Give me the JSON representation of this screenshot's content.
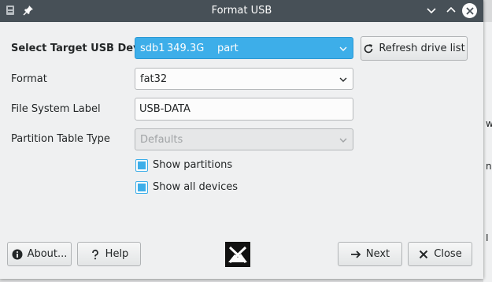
{
  "background": {
    "fragments": [
      "w",
      "nd",
      "I"
    ]
  },
  "window": {
    "title": "Format USB"
  },
  "form": {
    "device": {
      "label": "Select Target USB Device",
      "name": "sdb1",
      "size": "349.3G",
      "type": "part"
    },
    "refresh_label": "Refresh drive list",
    "format": {
      "label": "Format",
      "value": "fat32"
    },
    "fs_label": {
      "label": "File System Label",
      "value": "USB-DATA"
    },
    "partition_table": {
      "label": "Partition Table Type",
      "value": "Defaults"
    },
    "show_partitions": {
      "label": "Show partitions",
      "checked": true
    },
    "show_all_devices": {
      "label": "Show all devices",
      "checked": true
    }
  },
  "buttons": {
    "about": "About...",
    "help": "Help",
    "next": "Next",
    "close": "Close"
  },
  "colors": {
    "accent": "#3daee9",
    "titlebar": "#475057",
    "window_bg": "#eff0f1"
  }
}
